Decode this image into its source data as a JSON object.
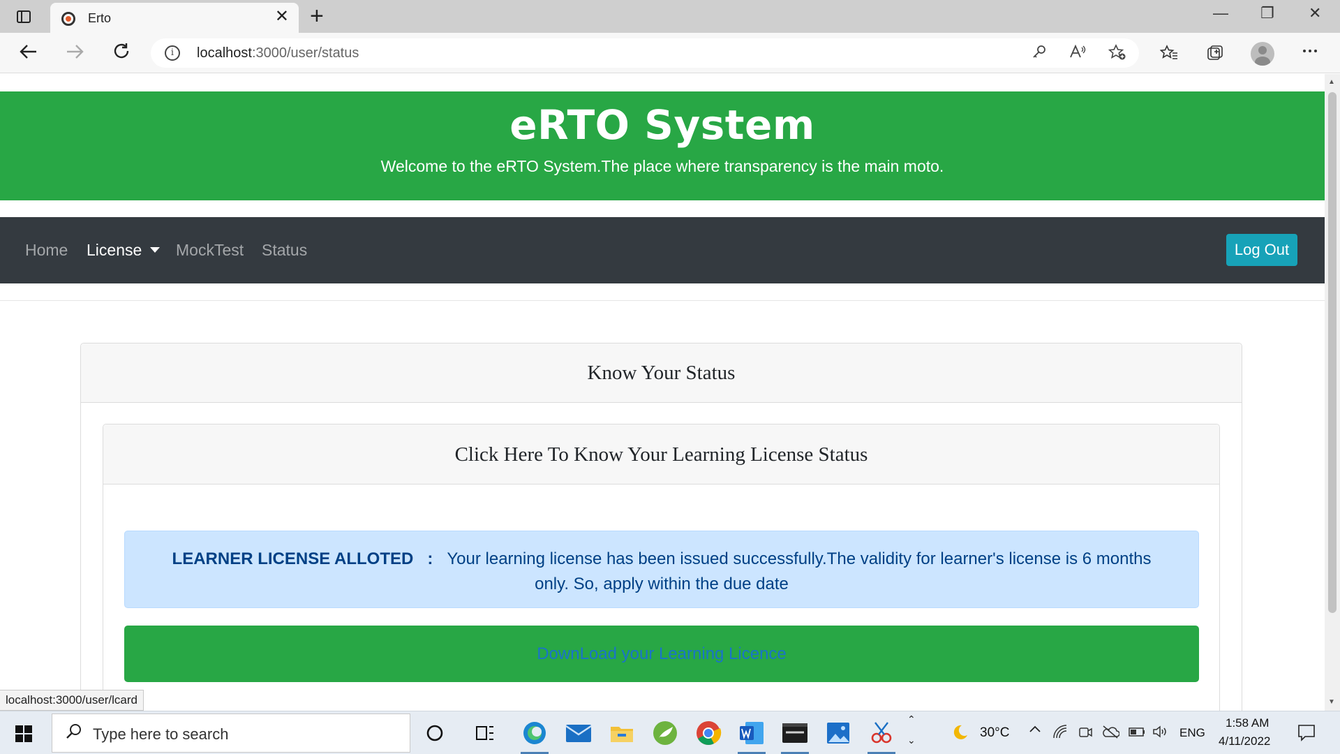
{
  "browser": {
    "tab_title": "Erto",
    "close_tab_glyph": "✕",
    "new_tab_glyph": "+",
    "url_host": "localhost",
    "url_path": ":3000/user/status",
    "window_controls": {
      "minimize": "—",
      "maximize": "❐",
      "close": "✕"
    }
  },
  "header": {
    "title": "eRTO System",
    "subtitle": "Welcome to the eRTO System.The place where transparency is the main moto."
  },
  "navbar": {
    "items": [
      {
        "label": "Home"
      },
      {
        "label": "License"
      },
      {
        "label": "MockTest"
      },
      {
        "label": "Status"
      }
    ],
    "logout_label": "Log Out"
  },
  "status_card": {
    "title": "Know Your Status",
    "inner_title": "Click Here To Know Your Learning License Status",
    "alert_heading": "LEARNER LICENSE ALLOTED",
    "alert_separator": ":",
    "alert_message": "Your learning license has been issued successfully.The validity for learner's license is 6 months only. So, apply within the due date",
    "download_label": "DownLoad your Learning Licence"
  },
  "status_bar_url": "localhost:3000/user/lcard",
  "taskbar": {
    "search_placeholder": "Type here to search",
    "weather": "30°C",
    "language": "ENG",
    "time": "1:58 AM",
    "date": "4/11/2022"
  },
  "colors": {
    "brand_green": "#28a745",
    "navbar_dark": "#343a40",
    "logout_info": "#17a2b8",
    "alert_bg": "#cce5ff",
    "alert_text": "#004085"
  }
}
